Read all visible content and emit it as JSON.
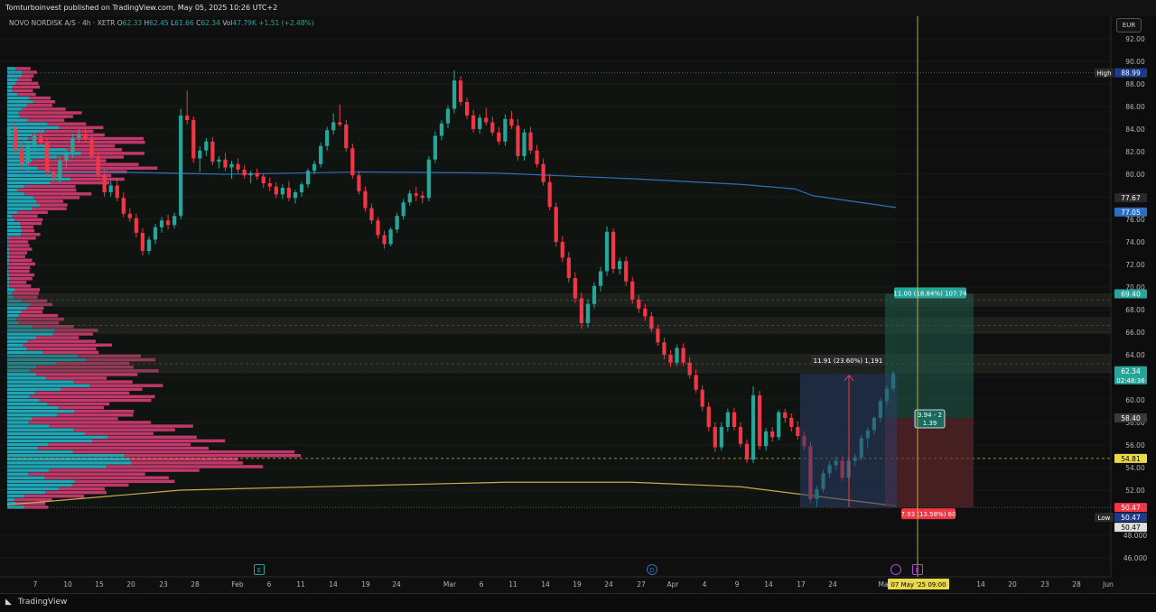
{
  "header": {
    "published": "Tomturboinvest published on TradingView.com, May 05, 2025 10:26 UTC+2"
  },
  "legend": {
    "symbol": "NOVO NORDISK A/S · 4h · XETR",
    "o_label": "O",
    "o": "62.33",
    "h_label": "H",
    "h": "62.45",
    "l_label": "L",
    "l": "61.66",
    "c_label": "C",
    "c": "62.34",
    "vol_label": "Vol",
    "vol": "47.79K",
    "change": "+1.51 (+2.48%)"
  },
  "currency": "EUR",
  "footer": {
    "logo": "TradingView"
  },
  "colors": {
    "up": "#26a69a",
    "down": "#f23645",
    "vp_up": "#25b5c9",
    "vp_down": "#e0407a",
    "ma_blue": "#2e6ec0",
    "ma_yellow": "#c9a94a",
    "bg": "#0f0f0f"
  },
  "chart_data": {
    "type": "candlestick",
    "symbol": "NOVO NORDISK A/S",
    "interval": "4h",
    "exchange": "XETR",
    "y_axis_ticks": [
      46,
      48,
      52,
      54,
      56,
      58,
      60,
      62,
      64,
      66,
      68,
      70,
      72,
      74,
      76,
      78,
      80,
      82,
      84,
      86,
      88,
      90,
      92
    ],
    "y_axis_tick_labels": [
      "46.000",
      "48.000",
      "52.00",
      "54.00",
      "56.00",
      "58.00",
      "60.00",
      "62.00",
      "64.00",
      "66.00",
      "68.00",
      "70.00",
      "72.00",
      "74.00",
      "76.00",
      "78.00",
      "80.00",
      "82.00",
      "84.00",
      "86.00",
      "88.00",
      "90.00",
      "92.00"
    ],
    "x_axis_labels": [
      "7",
      "10",
      "15",
      "20",
      "23",
      "28",
      "Feb",
      "6",
      "11",
      "14",
      "19",
      "24",
      "Mar",
      "6",
      "11",
      "14",
      "19",
      "24",
      "27",
      "Apr",
      "4",
      "9",
      "14",
      "17",
      "24",
      "Ma",
      "14",
      "20",
      "23",
      "28",
      "Jun"
    ],
    "price_labels": [
      {
        "label": "High",
        "value": "88.99"
      },
      {
        "label": "",
        "value": "77.67"
      },
      {
        "label": "",
        "value": "77.05"
      },
      {
        "label": "",
        "value": "69.40"
      },
      {
        "label": "",
        "value": "62.34",
        "sub": "02:48:36"
      },
      {
        "label": "",
        "value": "58.40"
      },
      {
        "label": "",
        "value": "54.81"
      },
      {
        "label": "",
        "value": "50.47"
      },
      {
        "label": "Low",
        "value": "50.47"
      },
      {
        "label": "",
        "value": "50.47"
      }
    ],
    "position": {
      "entry": 58.4,
      "target": 69.4,
      "stop": 50.47,
      "target_text": "11.00 (18.84%) 107.74",
      "stop_text": "7.93 (13.58%) 60",
      "rr_text_1": "3.94 - 2",
      "rr_text_2": "1.39"
    },
    "measure": {
      "from": 50.47,
      "to": 62.34,
      "text": "11.91 (23.60%) 1,191"
    },
    "event_markers": [
      {
        "letter": "E",
        "at": "Feb 3"
      },
      {
        "letter": "D",
        "at": "Mar 31"
      },
      {
        "letter": "E",
        "at": "May 7"
      }
    ],
    "cursor_date_label": "07 May '25  09:00",
    "candles": [
      [
        83.4,
        84.3,
        82.8,
        84.0
      ],
      [
        84.0,
        84.6,
        81.8,
        82.2
      ],
      [
        82.2,
        82.9,
        80.4,
        81.0
      ],
      [
        81.0,
        82.9,
        80.3,
        82.5
      ],
      [
        82.5,
        83.8,
        82.0,
        83.4
      ],
      [
        83.4,
        84.2,
        82.4,
        82.8
      ],
      [
        82.8,
        83.3,
        79.8,
        80.2
      ],
      [
        80.2,
        80.6,
        79.2,
        79.6
      ],
      [
        79.6,
        81.6,
        79.2,
        81.2
      ],
      [
        81.2,
        82.2,
        80.6,
        81.8
      ],
      [
        81.8,
        83.6,
        81.4,
        83.2
      ],
      [
        83.2,
        84.0,
        82.8,
        83.6
      ],
      [
        83.6,
        84.1,
        82.9,
        83.1
      ],
      [
        83.1,
        83.4,
        81.2,
        81.6
      ],
      [
        81.6,
        82.0,
        79.5,
        80.0
      ],
      [
        80.0,
        80.4,
        78.0,
        78.4
      ],
      [
        78.4,
        79.4,
        78.0,
        79.0
      ],
      [
        79.0,
        79.6,
        77.6,
        77.9
      ],
      [
        77.9,
        78.4,
        76.2,
        76.5
      ],
      [
        76.5,
        77.0,
        75.8,
        76.1
      ],
      [
        76.1,
        76.5,
        74.4,
        74.8
      ],
      [
        74.8,
        75.2,
        72.8,
        73.2
      ],
      [
        73.2,
        74.5,
        72.9,
        74.2
      ],
      [
        74.2,
        75.6,
        73.8,
        75.3
      ],
      [
        75.3,
        76.2,
        74.8,
        75.9
      ],
      [
        75.9,
        76.4,
        75.1,
        75.5
      ],
      [
        75.5,
        76.6,
        75.2,
        76.3
      ],
      [
        76.3,
        85.8,
        76.0,
        85.2
      ],
      [
        85.2,
        87.4,
        84.4,
        84.8
      ],
      [
        84.8,
        85.1,
        81.0,
        81.4
      ],
      [
        81.4,
        82.5,
        80.2,
        82.1
      ],
      [
        82.1,
        83.2,
        81.6,
        82.9
      ],
      [
        82.9,
        83.3,
        80.8,
        81.1
      ],
      [
        81.1,
        81.6,
        80.5,
        81.3
      ],
      [
        81.3,
        81.9,
        80.3,
        80.6
      ],
      [
        80.6,
        81.2,
        79.6,
        80.9
      ],
      [
        80.9,
        81.4,
        80.1,
        80.4
      ],
      [
        80.4,
        80.8,
        79.6,
        79.9
      ],
      [
        79.9,
        80.3,
        79.2,
        80.1
      ],
      [
        80.1,
        80.5,
        79.5,
        79.8
      ],
      [
        79.8,
        80.1,
        78.8,
        79.2
      ],
      [
        79.2,
        79.7,
        78.5,
        78.9
      ],
      [
        78.9,
        79.3,
        77.9,
        78.2
      ],
      [
        78.2,
        79.1,
        77.8,
        78.8
      ],
      [
        78.8,
        79.4,
        77.6,
        77.9
      ],
      [
        77.9,
        78.6,
        77.4,
        78.4
      ],
      [
        78.4,
        79.3,
        78.0,
        79.1
      ],
      [
        79.1,
        80.5,
        78.8,
        80.3
      ],
      [
        80.3,
        81.2,
        80.0,
        80.9
      ],
      [
        80.9,
        82.8,
        80.6,
        82.5
      ],
      [
        82.5,
        84.2,
        82.1,
        83.9
      ],
      [
        83.9,
        85.4,
        83.5,
        84.6
      ],
      [
        84.6,
        86.2,
        84.2,
        84.4
      ],
      [
        84.4,
        84.8,
        82.0,
        82.3
      ],
      [
        82.3,
        82.7,
        79.6,
        79.9
      ],
      [
        79.9,
        80.3,
        78.2,
        78.5
      ],
      [
        78.5,
        78.9,
        76.7,
        77.0
      ],
      [
        77.0,
        77.4,
        75.6,
        75.9
      ],
      [
        75.9,
        76.2,
        74.3,
        74.6
      ],
      [
        74.6,
        75.0,
        73.4,
        73.8
      ],
      [
        73.8,
        75.3,
        73.6,
        75.1
      ],
      [
        75.1,
        76.6,
        74.8,
        76.3
      ],
      [
        76.3,
        77.8,
        76.0,
        77.5
      ],
      [
        77.5,
        78.6,
        77.2,
        78.3
      ],
      [
        78.3,
        78.9,
        77.6,
        78.1
      ],
      [
        78.1,
        78.5,
        77.4,
        77.9
      ],
      [
        77.9,
        81.6,
        77.6,
        81.3
      ],
      [
        81.3,
        83.8,
        81.0,
        83.4
      ],
      [
        83.4,
        84.8,
        83.0,
        84.5
      ],
      [
        84.5,
        86.1,
        84.1,
        85.8
      ],
      [
        85.8,
        89.2,
        85.4,
        88.3
      ],
      [
        88.3,
        88.7,
        86.1,
        86.4
      ],
      [
        86.4,
        86.8,
        84.9,
        85.2
      ],
      [
        85.2,
        85.7,
        83.7,
        84.0
      ],
      [
        84.0,
        85.3,
        83.6,
        85.0
      ],
      [
        85.0,
        85.9,
        84.3,
        84.6
      ],
      [
        84.6,
        85.1,
        83.4,
        83.7
      ],
      [
        83.7,
        84.2,
        82.6,
        82.9
      ],
      [
        82.9,
        85.3,
        82.5,
        84.9
      ],
      [
        84.9,
        85.6,
        84.0,
        84.3
      ],
      [
        84.3,
        84.9,
        81.2,
        81.6
      ],
      [
        81.6,
        84.0,
        81.2,
        83.7
      ],
      [
        83.7,
        84.2,
        81.8,
        82.1
      ],
      [
        82.1,
        82.6,
        80.6,
        80.9
      ],
      [
        80.9,
        81.4,
        79.0,
        79.3
      ],
      [
        79.3,
        80.0,
        76.8,
        77.1
      ],
      [
        77.1,
        77.5,
        73.6,
        74.0
      ],
      [
        74.0,
        74.5,
        72.2,
        72.6
      ],
      [
        72.6,
        73.1,
        70.4,
        70.8
      ],
      [
        70.8,
        71.3,
        68.6,
        69.0
      ],
      [
        69.0,
        69.5,
        66.3,
        66.8
      ],
      [
        66.8,
        68.9,
        66.4,
        68.5
      ],
      [
        68.5,
        70.4,
        68.1,
        70.1
      ],
      [
        70.1,
        71.8,
        69.6,
        71.4
      ],
      [
        71.4,
        75.4,
        71.0,
        74.9
      ],
      [
        74.9,
        75.2,
        71.2,
        71.6
      ],
      [
        71.6,
        72.6,
        71.1,
        72.3
      ],
      [
        72.3,
        72.7,
        70.1,
        70.5
      ],
      [
        70.5,
        70.9,
        68.5,
        68.9
      ],
      [
        68.9,
        69.3,
        67.7,
        68.1
      ],
      [
        68.1,
        68.5,
        67.0,
        67.4
      ],
      [
        67.4,
        67.8,
        66.0,
        66.3
      ],
      [
        66.3,
        66.6,
        64.8,
        65.1
      ],
      [
        65.1,
        65.5,
        63.6,
        64.0
      ],
      [
        64.0,
        64.4,
        62.9,
        63.3
      ],
      [
        63.3,
        64.9,
        63.0,
        64.6
      ],
      [
        64.6,
        65.0,
        63.0,
        63.3
      ],
      [
        63.3,
        63.8,
        61.9,
        62.2
      ],
      [
        62.2,
        62.7,
        60.6,
        60.9
      ],
      [
        60.9,
        61.3,
        59.0,
        59.4
      ],
      [
        59.4,
        59.8,
        57.2,
        57.6
      ],
      [
        57.6,
        58.0,
        55.4,
        55.8
      ],
      [
        55.8,
        58.0,
        55.5,
        57.6
      ],
      [
        57.6,
        59.2,
        57.2,
        58.9
      ],
      [
        58.9,
        59.3,
        57.3,
        57.6
      ],
      [
        57.6,
        58.0,
        55.8,
        56.1
      ],
      [
        56.1,
        56.5,
        54.4,
        54.7
      ],
      [
        54.7,
        61.2,
        54.4,
        60.4
      ],
      [
        60.4,
        60.8,
        55.6,
        55.9
      ],
      [
        55.9,
        57.5,
        55.5,
        57.2
      ],
      [
        57.2,
        57.6,
        56.3,
        56.7
      ],
      [
        56.7,
        59.1,
        56.4,
        58.9
      ],
      [
        58.9,
        59.2,
        58.0,
        58.4
      ],
      [
        58.4,
        58.8,
        57.2,
        57.6
      ],
      [
        57.6,
        58.1,
        56.5,
        56.8
      ],
      [
        56.8,
        57.2,
        55.5,
        55.9
      ],
      [
        55.9,
        56.3,
        50.9,
        51.2
      ],
      [
        51.2,
        52.4,
        50.5,
        52.1
      ],
      [
        52.1,
        53.8,
        51.8,
        53.5
      ],
      [
        53.5,
        54.6,
        53.1,
        54.2
      ],
      [
        54.2,
        55.0,
        53.8,
        54.6
      ],
      [
        54.6,
        55.1,
        52.8,
        53.1
      ],
      [
        53.1,
        54.9,
        52.8,
        54.6
      ],
      [
        54.6,
        55.2,
        54.1,
        54.9
      ],
      [
        54.9,
        56.9,
        54.6,
        56.6
      ],
      [
        56.6,
        57.6,
        55.7,
        57.3
      ],
      [
        57.3,
        58.6,
        56.9,
        58.4
      ],
      [
        58.4,
        60.2,
        58.0,
        59.9
      ],
      [
        59.9,
        61.3,
        59.5,
        61.0
      ],
      [
        61.0,
        62.5,
        60.7,
        62.3
      ]
    ]
  }
}
